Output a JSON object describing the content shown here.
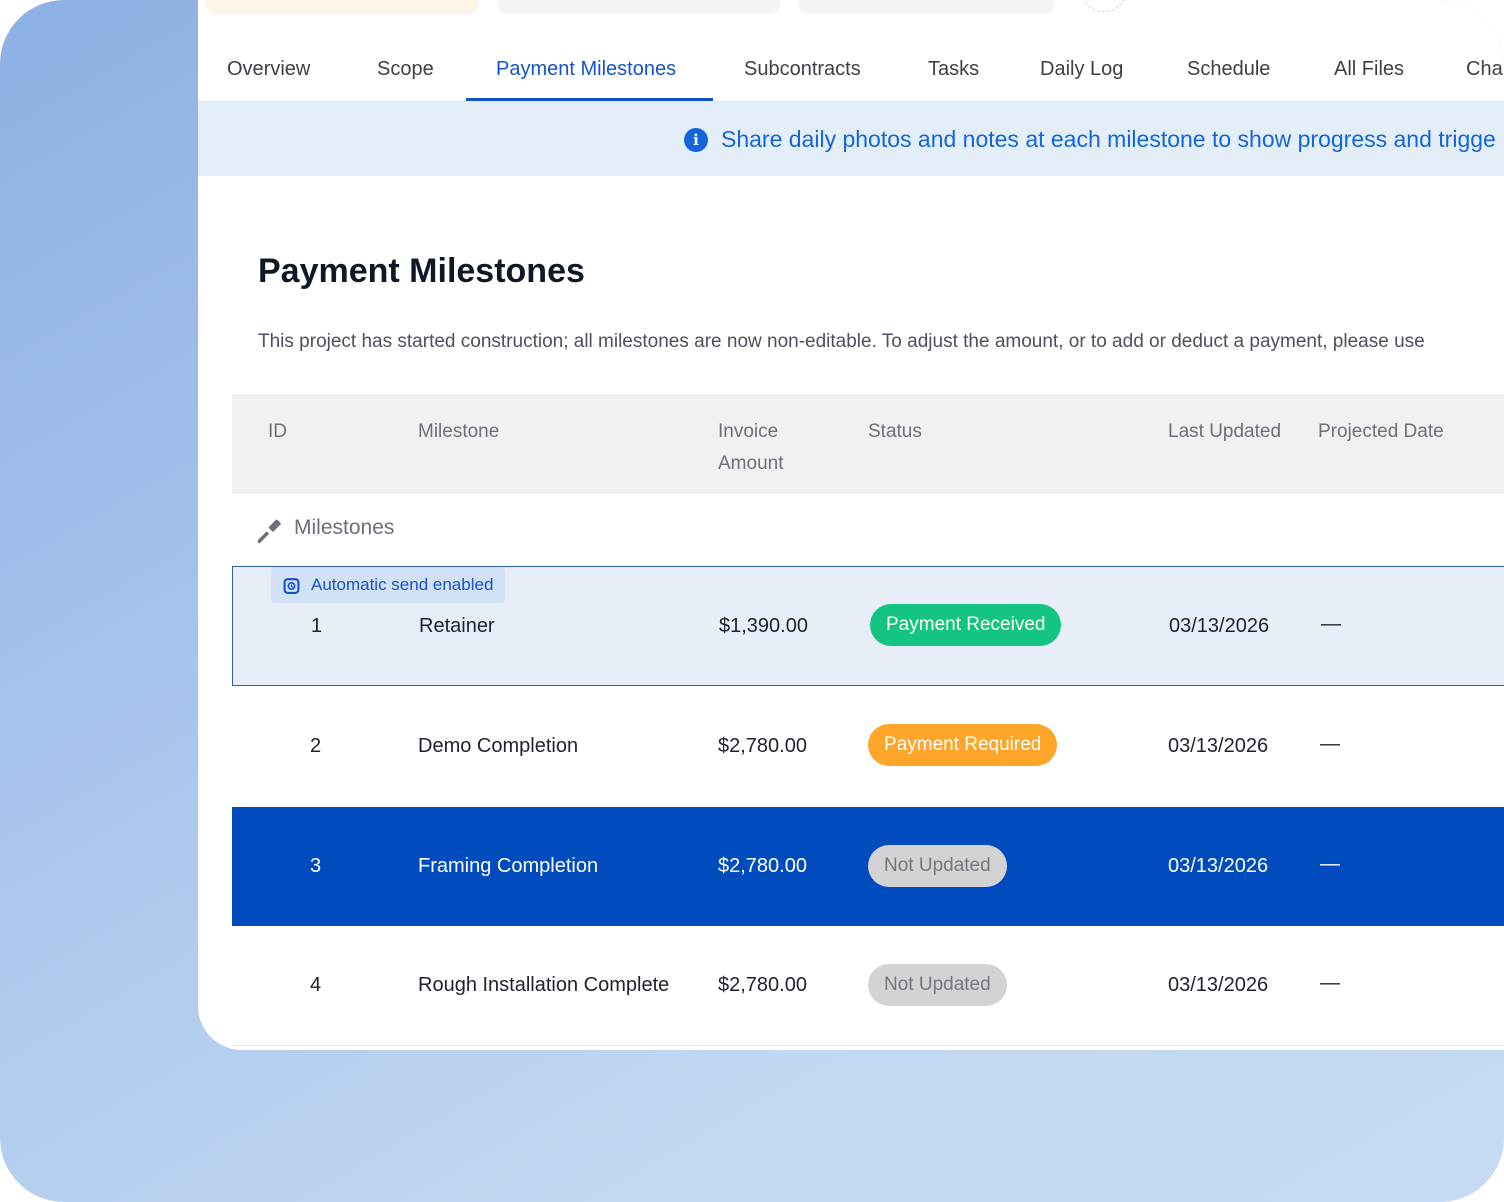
{
  "tabs": [
    {
      "label": "Overview"
    },
    {
      "label": "Scope"
    },
    {
      "label": "Payment Milestones"
    },
    {
      "label": "Subcontracts"
    },
    {
      "label": "Tasks"
    },
    {
      "label": "Daily Log"
    },
    {
      "label": "Schedule"
    },
    {
      "label": "All Files"
    },
    {
      "label": "Cha"
    }
  ],
  "banner": {
    "text": "Share daily photos and notes at each milestone to show progress and trigge"
  },
  "page": {
    "title": "Payment Milestones",
    "description": "This project has started construction; all milestones are now non-editable. To adjust the amount, or to add or deduct a payment, please use"
  },
  "table": {
    "headers": {
      "id": "ID",
      "milestone": "Milestone",
      "invoice_line1": "Invoice",
      "invoice_line2": "Amount",
      "status": "Status",
      "last_updated": "Last Updated",
      "projected_date": "Projected Date"
    },
    "group_label": "Milestones",
    "auto_send_label": "Automatic send enabled",
    "rows": [
      {
        "id": "1",
        "milestone": "Retainer",
        "amount": "$1,390.00",
        "status": "Payment Received",
        "last_updated": "03/13/2026",
        "projected": "—"
      },
      {
        "id": "2",
        "milestone": "Demo Completion",
        "amount": "$2,780.00",
        "status": "Payment Required",
        "last_updated": "03/13/2026",
        "projected": "—"
      },
      {
        "id": "3",
        "milestone": "Framing Completion",
        "amount": "$2,780.00",
        "status": "Not Updated",
        "last_updated": "03/13/2026",
        "projected": "—"
      },
      {
        "id": "4",
        "milestone": "Rough Installation Complete",
        "amount": "$2,780.00",
        "status": "Not Updated",
        "last_updated": "03/13/2026",
        "projected": "—"
      }
    ]
  },
  "colors": {
    "accent": "#1553c8",
    "selected_row": "#004bbd",
    "status_received": "#13c483",
    "status_required": "#ffa52a",
    "status_not_updated": "#d3d3d5"
  }
}
